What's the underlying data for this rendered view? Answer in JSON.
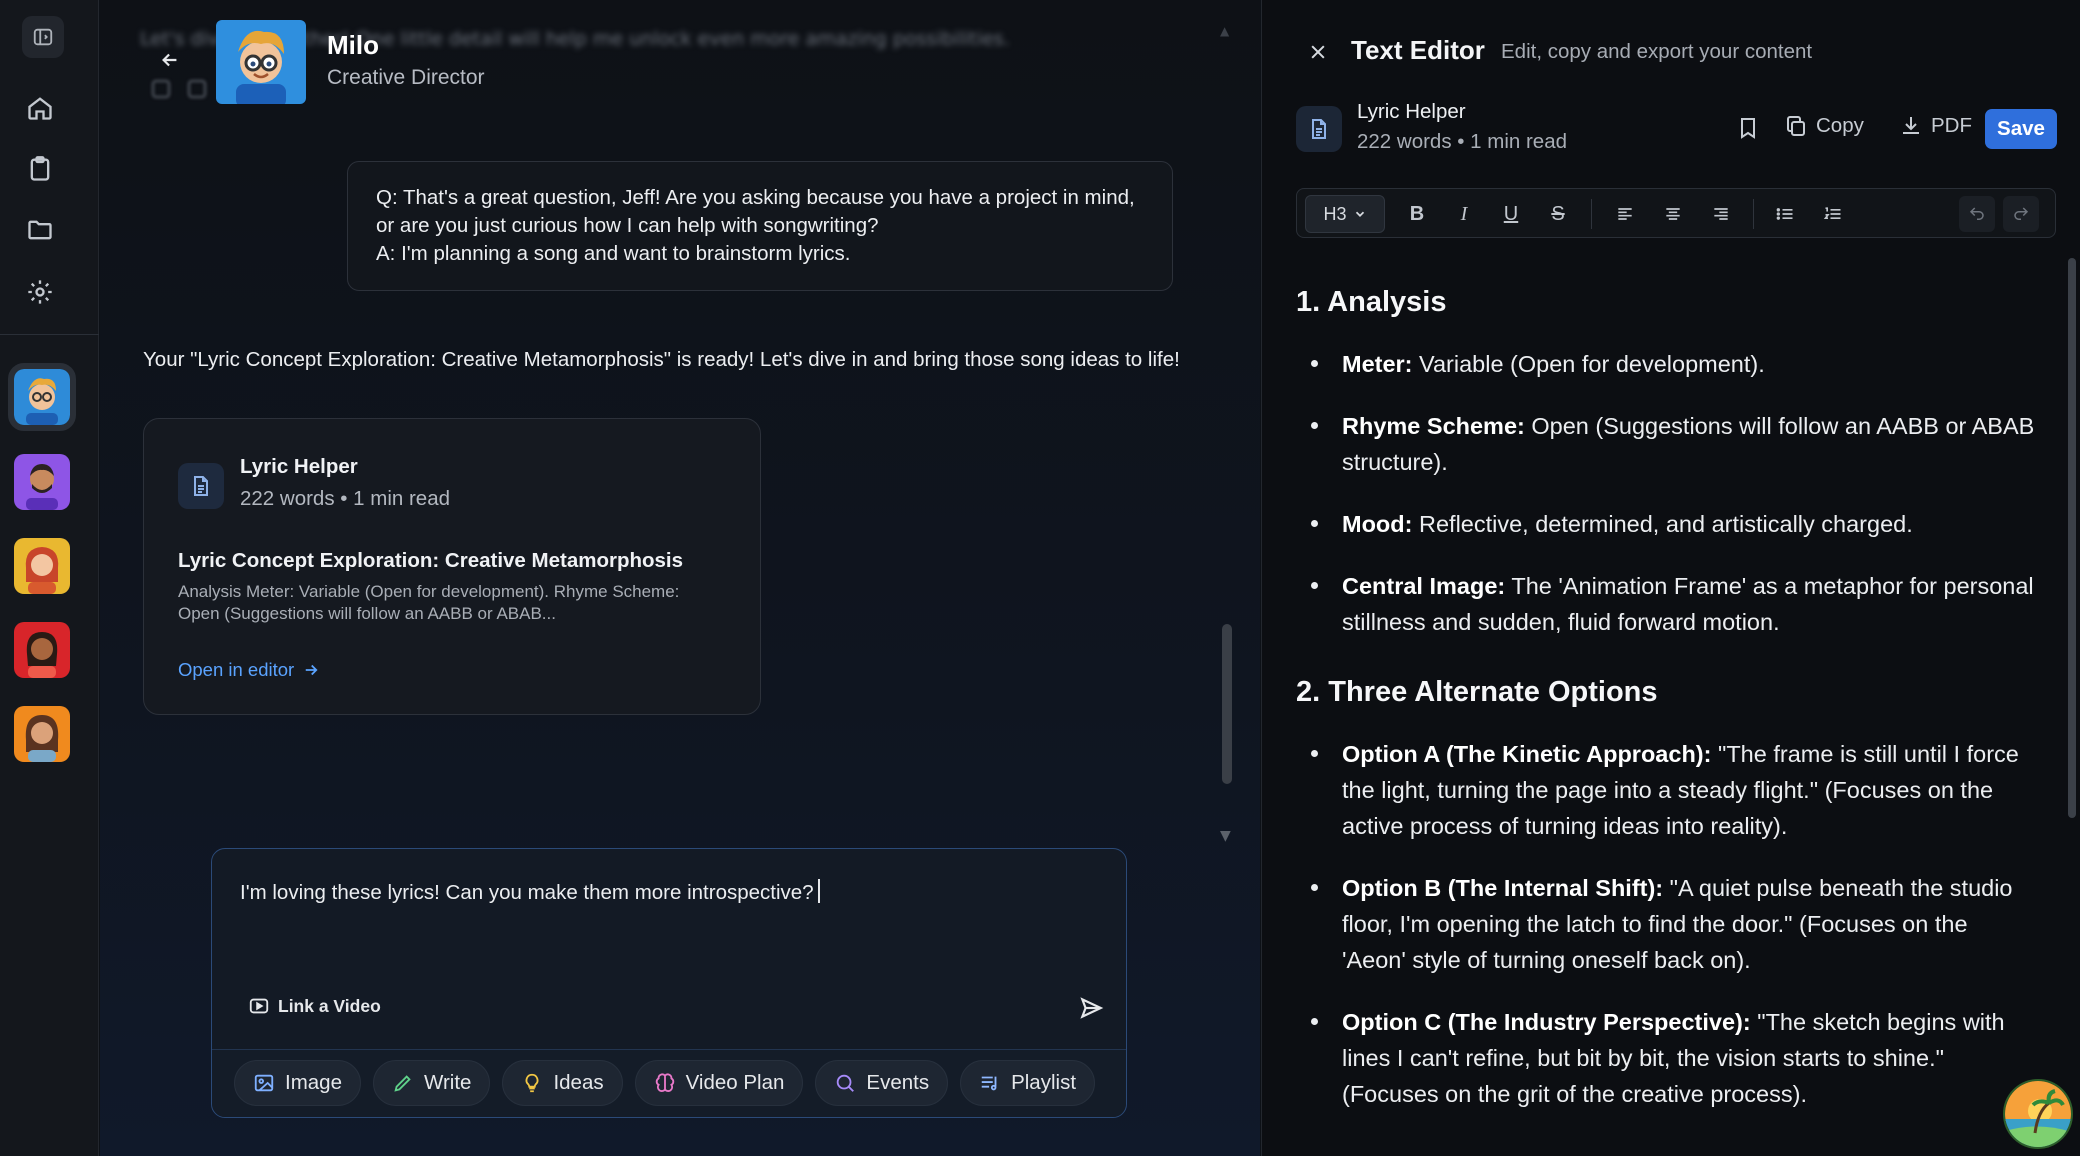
{
  "sidebar": {
    "nav": [
      {
        "name": "panel-toggle-icon"
      },
      {
        "name": "home-icon"
      },
      {
        "name": "clipboard-icon"
      },
      {
        "name": "folder-icon"
      },
      {
        "name": "gear-icon"
      }
    ],
    "avatars": [
      {
        "name": "avatar-milo",
        "active": true
      },
      {
        "name": "avatar-bearded-man"
      },
      {
        "name": "avatar-redhead-woman"
      },
      {
        "name": "avatar-woman-red"
      },
      {
        "name": "avatar-woman-orange"
      }
    ]
  },
  "chat": {
    "blurred_preview": "Let's dive in together! One little detail will help me unlock even more amazing possibilities.",
    "agent": {
      "name": "Milo",
      "role": "Creative Director"
    },
    "qa_lines": [
      "Q: That's a great question, Jeff! Are you asking because you have a project in mind, or are you just curious how I can help with songwriting?",
      "A: I'm planning a song and want to brainstorm lyrics."
    ],
    "ready_message": "Your \"Lyric Concept Exploration: Creative Metamorphosis\" is ready! Let's dive in and bring those song ideas to life!",
    "doc_card": {
      "title": "Lyric Helper",
      "meta": "222 words • 1 min read",
      "heading": "Lyric Concept Exploration: Creative Metamorphosis",
      "excerpt": "Analysis Meter: Variable (Open for development). Rhyme Scheme: Open (Suggestions will follow an AABB or ABAB...",
      "open_label": "Open in editor"
    },
    "composer": {
      "text": "I'm loving these lyrics! Can you make them more introspective?",
      "link_video_label": "Link a Video",
      "tools": [
        {
          "label": "Image",
          "icon": "image-icon"
        },
        {
          "label": "Write",
          "icon": "pencil-icon"
        },
        {
          "label": "Ideas",
          "icon": "lightbulb-icon"
        },
        {
          "label": "Video Plan",
          "icon": "brain-icon"
        },
        {
          "label": "Events",
          "icon": "search-icon"
        },
        {
          "label": "Playlist",
          "icon": "playlist-icon"
        }
      ]
    }
  },
  "editor": {
    "title": "Text Editor",
    "subtitle": "Edit, copy and export your content",
    "doc_title": "Lyric Helper",
    "doc_meta": "222 words • 1 min read",
    "copy_label": "Copy",
    "pdf_label": "PDF",
    "save_label": "Save",
    "heading_select": "H3",
    "sections": [
      {
        "heading": "1. Analysis",
        "items": [
          {
            "label": "Meter:",
            "text": " Variable (Open for development)."
          },
          {
            "label": "Rhyme Scheme:",
            "text": " Open (Suggestions will follow an AABB or ABAB structure)."
          },
          {
            "label": "Mood:",
            "text": " Reflective, determined, and artistically charged."
          },
          {
            "label": "Central Image:",
            "text": " The 'Animation Frame' as a metaphor for personal stillness and sudden, fluid forward motion."
          }
        ]
      },
      {
        "heading": "2. Three Alternate Options",
        "items": [
          {
            "label": "Option A (The Kinetic Approach):",
            "text": " \"The frame is still until I force the light, turning the page into a steady flight.\" (Focuses on the active process of turning ideas into reality)."
          },
          {
            "label": "Option B (The Internal Shift):",
            "text": " \"A quiet pulse beneath the studio floor, I'm opening the latch to find the door.\" (Focuses on the 'Aeon' style of turning oneself back on)."
          },
          {
            "label": "Option C (The Industry Perspective):",
            "text": " \"The sketch begins with lines I can't refine, but bit by bit, the vision starts to shine.\" (Focuses on the grit of the creative process)."
          }
        ]
      }
    ]
  },
  "colors": {
    "accent": "#2f6fdc",
    "link": "#5aa3ff",
    "background": "#0d1117"
  }
}
